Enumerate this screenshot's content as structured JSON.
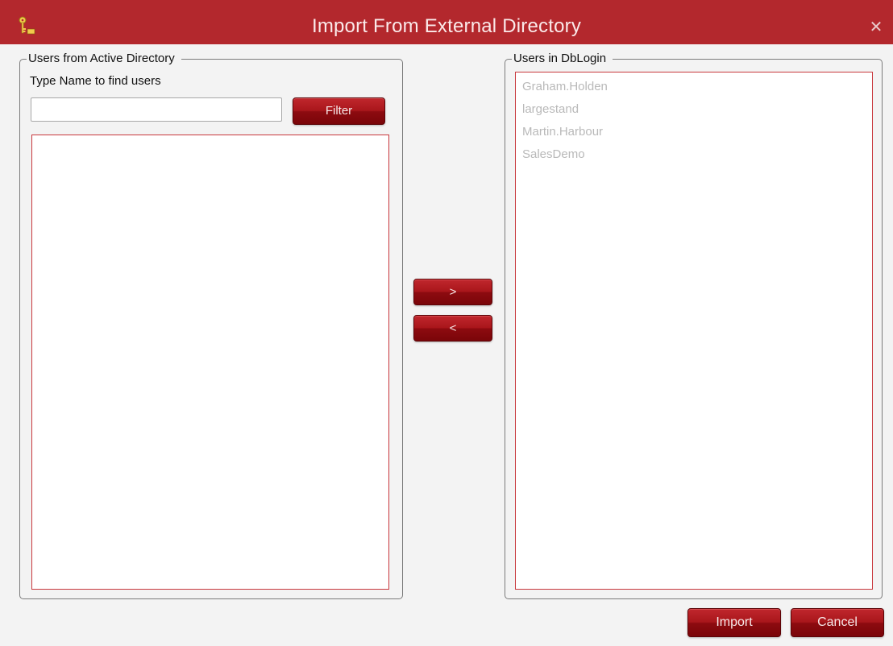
{
  "window": {
    "title": "Import From External Directory",
    "close_glyph": "✕",
    "icon": "key-icon"
  },
  "left_panel": {
    "legend": "Users from Active Directory",
    "find_label": "Type Name to find users",
    "search_value": "",
    "filter_label": "Filter",
    "items": []
  },
  "transfer": {
    "add_label": ">",
    "remove_label": "<"
  },
  "right_panel": {
    "legend": "Users in DbLogin",
    "items": [
      "Graham.Holden",
      "largestand",
      "Martin.Harbour",
      "SalesDemo"
    ]
  },
  "footer": {
    "import_label": "Import",
    "cancel_label": "Cancel"
  },
  "colors": {
    "titlebar": "#b3282d",
    "button": "#a9161b",
    "list_border": "#c8373c",
    "disabled_text": "#b9b9b9"
  }
}
